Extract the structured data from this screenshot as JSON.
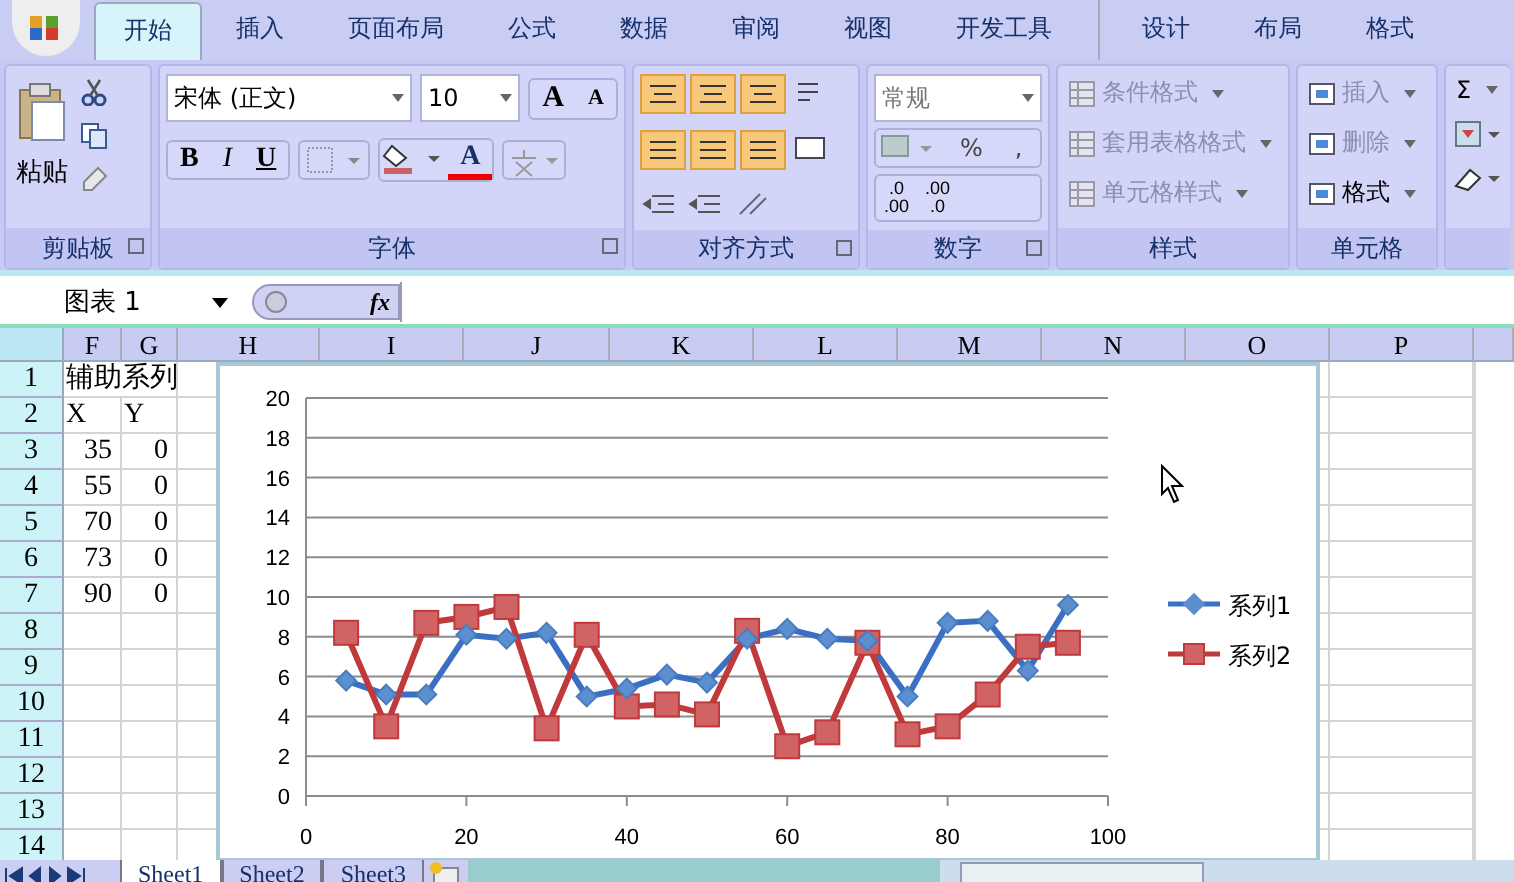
{
  "tabs": [
    {
      "label": "开始",
      "selected": true
    },
    {
      "label": "插入",
      "selected": false
    },
    {
      "label": "页面布局",
      "selected": false
    },
    {
      "label": "公式",
      "selected": false
    },
    {
      "label": "数据",
      "selected": false
    },
    {
      "label": "审阅",
      "selected": false
    },
    {
      "label": "视图",
      "selected": false
    },
    {
      "label": "开发工具",
      "selected": false
    }
  ],
  "context_tabs": [
    {
      "label": "设计",
      "selected": false
    },
    {
      "label": "布局",
      "selected": false
    },
    {
      "label": "格式",
      "selected": false
    }
  ],
  "ribbon": {
    "clipboard": {
      "paste": "粘贴",
      "label": "剪贴板"
    },
    "font": {
      "name": "宋体 (正文)",
      "size": "10",
      "grow": "A",
      "shrink": "A",
      "bold": "B",
      "italic": "I",
      "underline": "U",
      "font_color_button": "A",
      "label": "字体"
    },
    "alignment": {
      "label": "对齐方式"
    },
    "number": {
      "format": "常规",
      "disabled": true,
      "percent": "%",
      "comma": ",",
      "decimals": [
        {
          "top": ".0",
          "bottom": ".00"
        },
        {
          "top": ".00",
          "bottom": ".0"
        }
      ],
      "label": "数字"
    },
    "styles": {
      "items": [
        {
          "label": "条件格式",
          "disabled": true
        },
        {
          "label": "套用表格格式",
          "disabled": true
        },
        {
          "label": "单元格样式",
          "disabled": true
        }
      ],
      "label": "样式"
    },
    "cells": {
      "items": [
        {
          "label": "插入",
          "disabled": true
        },
        {
          "label": "删除",
          "disabled": true
        },
        {
          "label": "格式",
          "disabled": false
        }
      ],
      "label": "单元格"
    },
    "editing": {
      "sum": "Σ"
    }
  },
  "formula_bar": {
    "name_box": "图表 1",
    "fx": "fx"
  },
  "columns": [
    "F",
    "G",
    "H",
    "I",
    "J",
    "K",
    "L",
    "M",
    "N",
    "O",
    "P"
  ],
  "rows": [
    {
      "header": "1",
      "F": "辅助系列"
    },
    {
      "header": "2",
      "F": "X",
      "G": "Y"
    },
    {
      "header": "3",
      "F": "35",
      "G": "0"
    },
    {
      "header": "4",
      "F": "55",
      "G": "0"
    },
    {
      "header": "5",
      "F": "70",
      "G": "0"
    },
    {
      "header": "6",
      "F": "73",
      "G": "0"
    },
    {
      "header": "7",
      "F": "90",
      "G": "0"
    },
    {
      "header": "8"
    },
    {
      "header": "9"
    },
    {
      "header": "10"
    },
    {
      "header": "11"
    },
    {
      "header": "12"
    },
    {
      "header": "13"
    },
    {
      "header": "14"
    }
  ],
  "chart_data": {
    "type": "line",
    "grid": true,
    "legend": true,
    "x": [
      5,
      10,
      15,
      20,
      25,
      30,
      35,
      40,
      45,
      50,
      55,
      60,
      65,
      70,
      75,
      80,
      85,
      90,
      95
    ],
    "xlim": [
      0,
      100
    ],
    "ylim": [
      0,
      20
    ],
    "xticks": [
      0,
      20,
      40,
      60,
      80,
      100
    ],
    "yticks": [
      {
        "value": 0,
        "label": "0"
      },
      {
        "value": 2,
        "label": "2"
      },
      {
        "value": 4,
        "label": "4"
      },
      {
        "value": 6,
        "label": "6"
      },
      {
        "value": 8,
        "label": "8"
      },
      {
        "value": 10,
        "label": "10"
      },
      {
        "value": 12,
        "label": "12"
      },
      {
        "value": 14,
        "label": "14"
      },
      {
        "value": 16,
        "label": "16"
      },
      {
        "value": 18,
        "label": "18"
      },
      {
        "value": 20,
        "label": "20"
      }
    ],
    "series": [
      {
        "name": "系列1",
        "color": "#3a6fc4",
        "marker": "diamond",
        "values": [
          5.8,
          5.1,
          5.1,
          8.1,
          7.9,
          8.2,
          5.0,
          5.4,
          6.1,
          5.7,
          7.9,
          8.4,
          7.9,
          7.8,
          5.0,
          8.7,
          8.8,
          6.3,
          9.6
        ]
      },
      {
        "name": "系列2",
        "color": "#c0393b",
        "marker": "square",
        "values": [
          8.2,
          3.5,
          8.7,
          9.0,
          9.5,
          3.4,
          8.1,
          4.5,
          4.6,
          4.1,
          8.3,
          2.5,
          3.2,
          7.7,
          3.1,
          3.5,
          5.1,
          7.5,
          7.7
        ]
      }
    ]
  },
  "sheet_tabs": [
    {
      "label": "Sheet1",
      "selected": true
    },
    {
      "label": "Sheet2",
      "selected": false
    },
    {
      "label": "Sheet3",
      "selected": false
    }
  ]
}
